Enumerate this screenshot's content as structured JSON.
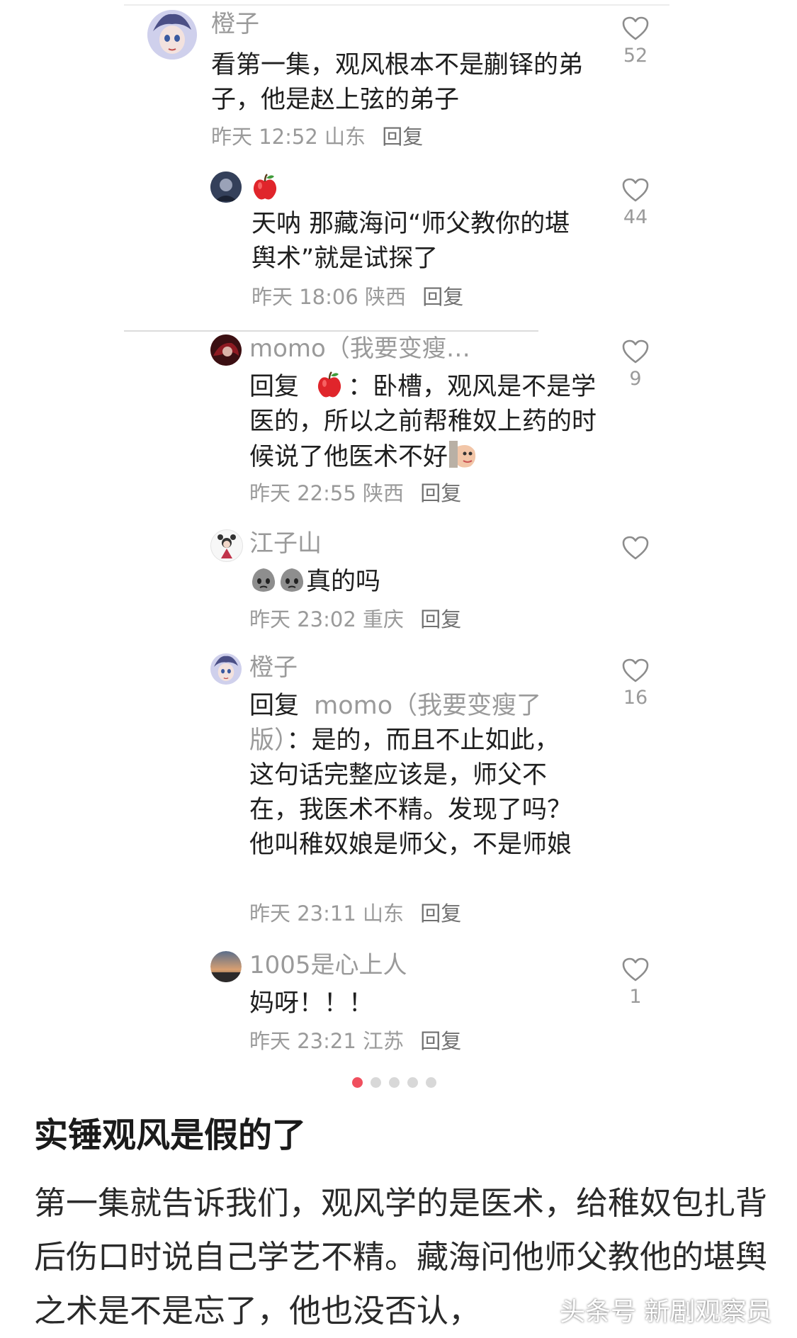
{
  "comments": [
    {
      "name": "橙子",
      "text": "看第一集，观风根本不是蒯铎的弟子，他是赵上弦的弟子",
      "date": "昨天 12:52",
      "location": "山东",
      "reply_label": "回复",
      "likes": "52"
    },
    {
      "name": "",
      "name_icon": "apple-emoji",
      "text": "天呐 那藏海问“师父教你的堪舆术”就是试探了",
      "date": "昨天 18:06",
      "location": "陕西",
      "reply_label": "回复",
      "likes": "44"
    },
    {
      "name": "momo（我要变瘦…",
      "reply_prefix": "回复",
      "reply_target_icon": "apple-emoji",
      "text": "：卧槽，观风是不是学医的，所以之前帮稚奴上药的时候说了他医术不好",
      "trailing_icon": "peek-sticker-icon",
      "date": "昨天 22:55",
      "location": "陕西",
      "reply_label": "回复",
      "likes": "9"
    },
    {
      "name": "江子山",
      "leading_icons": [
        "sad-blob-emoji",
        "sad-blob-emoji"
      ],
      "text": "真的吗",
      "date": "昨天 23:02",
      "location": "重庆",
      "reply_label": "回复",
      "likes": ""
    },
    {
      "name": "橙子",
      "reply_prefix": "回复",
      "reply_target": "momo（我要变瘦了版）",
      "text": "：是的，而且不止如此，这句话完整应该是，师父不在，我医术不精。发现了吗？他叫稚奴娘是师父，不是师娘",
      "date": "昨天 23:11",
      "location": "山东",
      "reply_label": "回复",
      "likes": "16"
    },
    {
      "name": "1005是心上人",
      "text": "妈呀！！！",
      "date": "昨天 23:21",
      "location": "江苏",
      "reply_label": "回复",
      "likes": "1"
    }
  ],
  "carousel": {
    "count": 5,
    "active_index": 0,
    "active_color": "#f04f5e",
    "inactive_color": "#d8d8d8"
  },
  "article": {
    "heading": "实锤观风是假的了",
    "paragraph": "第一集就告诉我们，观风学的是医术，给稚奴包扎背后伤口时说自己学艺不精。藏海问他师父教他的堪舆之术是不是忘了，他也没否认，"
  },
  "watermark": "头条号 新剧观察员"
}
